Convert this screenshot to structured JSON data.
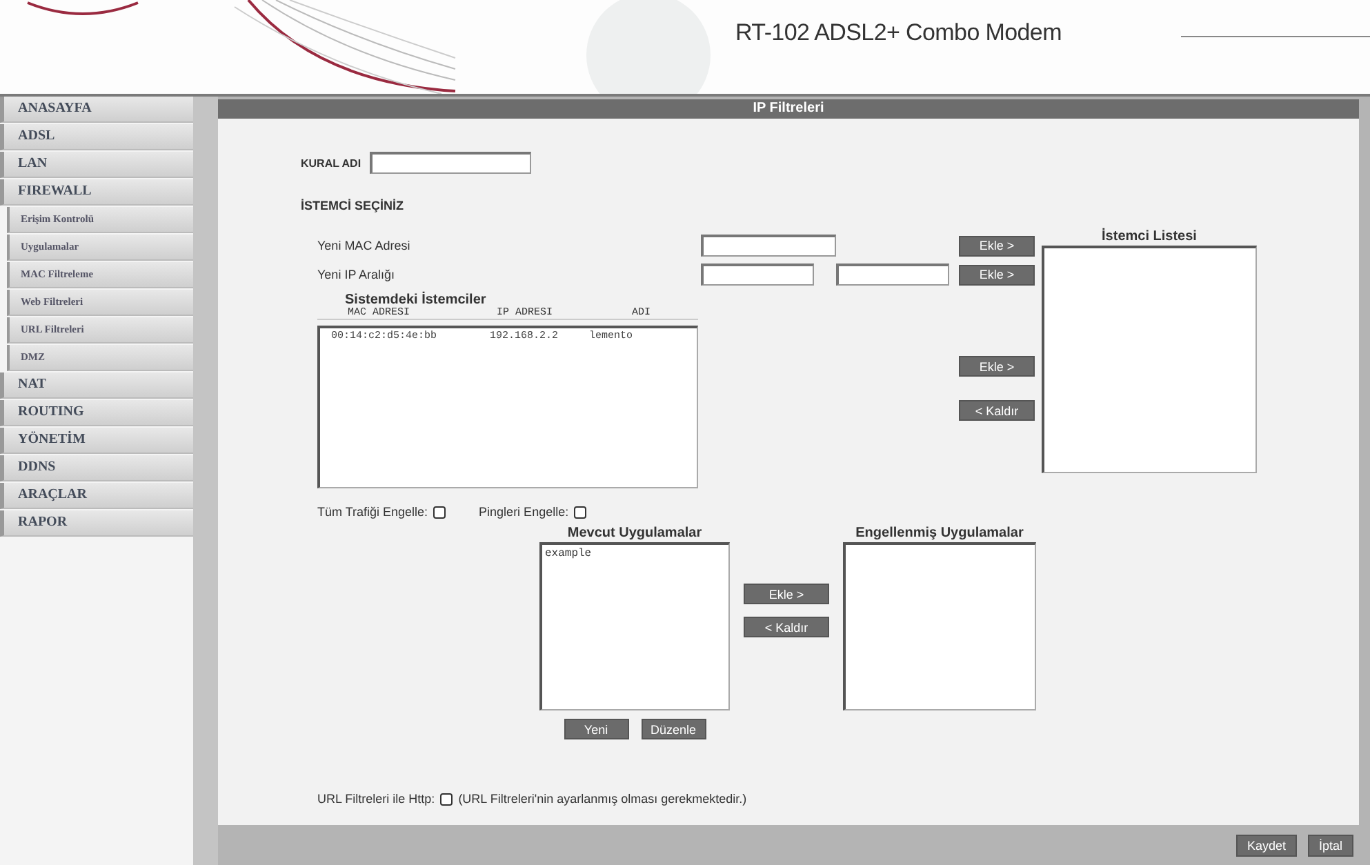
{
  "header": {
    "title": "RT-102 ADSL2+ Combo Modem"
  },
  "sidebar": {
    "items": [
      {
        "label": "ANASAYFA"
      },
      {
        "label": "ADSL"
      },
      {
        "label": "LAN"
      },
      {
        "label": "FIREWALL",
        "children": [
          {
            "label": "Erişim Kontrolü"
          },
          {
            "label": "Uygulamalar"
          },
          {
            "label": "MAC Filtreleme"
          },
          {
            "label": "Web Filtreleri"
          },
          {
            "label": "URL Filtreleri"
          },
          {
            "label": "DMZ"
          }
        ]
      },
      {
        "label": "NAT"
      },
      {
        "label": "ROUTING"
      },
      {
        "label": "YÖNETİM"
      },
      {
        "label": "DDNS"
      },
      {
        "label": "ARAÇLAR"
      },
      {
        "label": "RAPOR"
      }
    ]
  },
  "page_title": "IP Filtreleri",
  "rule_name": {
    "label": "KURAL ADI"
  },
  "section_title": "İSTEMCİ SEÇİNİZ",
  "new_mac": {
    "label": "Yeni MAC Adresi",
    "button": "Ekle >"
  },
  "new_ip": {
    "label": "Yeni IP Aralığı",
    "button": "Ekle >"
  },
  "clients": {
    "title": "Sistemdeki İstemciler",
    "columns": [
      "MAC ADRESI",
      "IP ADRESI",
      "ADI"
    ],
    "rows": [
      [
        "00:14:c2:d5:4e:bb",
        "192.168.2.2",
        "lemento"
      ]
    ]
  },
  "client_buttons": [
    "Ekle >",
    "< Kaldır"
  ],
  "client_list": {
    "title": "İstemci Listesi"
  },
  "options": [
    {
      "label": "Tüm Trafiği Engelle:",
      "checked": false
    },
    {
      "label": "Pingleri Engelle:",
      "checked": false
    }
  ],
  "available_apps": {
    "title": "Mevcut Uygulamalar",
    "items": [
      "example"
    ]
  },
  "app_buttons": [
    "Ekle >",
    "< Kaldır"
  ],
  "blocked_apps": {
    "title": "Engellenmiş Uygulamalar"
  },
  "app_edit_buttons": [
    "Yeni",
    "Düzenle"
  ],
  "url_filter": {
    "label": "URL Filtreleri ile Http:",
    "checked": false,
    "note": "(URL Filtreleri'nin ayarlanmış olması gerekmektedir.)"
  },
  "footer_buttons": [
    "Kaydet",
    "İptal"
  ]
}
